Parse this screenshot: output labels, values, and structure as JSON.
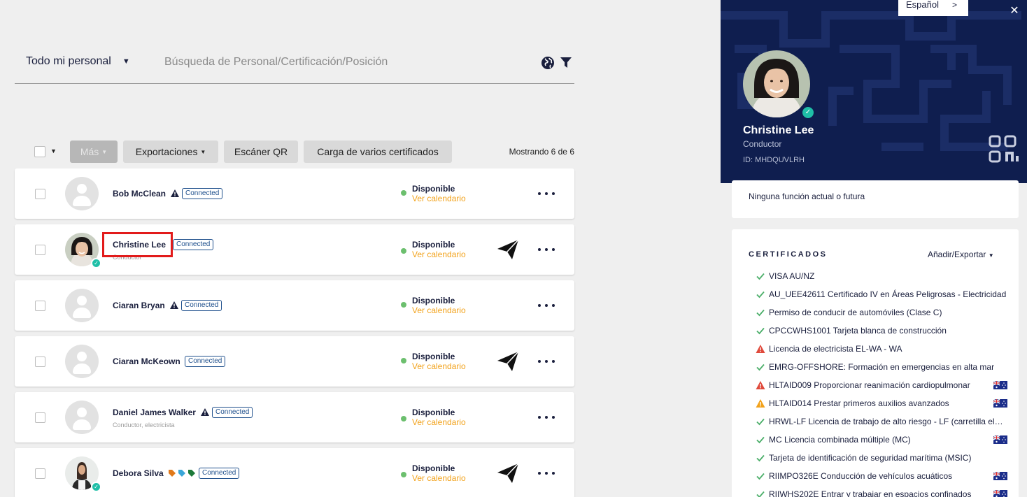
{
  "search": {
    "filter_label": "Todo mi personal",
    "placeholder": "Búsqueda de Personal/Certificación/Posición"
  },
  "toolbar": {
    "more_label": "Más",
    "exports_label": "Exportaciones",
    "qr_label": "Escáner QR",
    "bulk_label": "Carga de varios certificados",
    "showing": "Mostrando 6 de 6"
  },
  "people": [
    {
      "name": "Bob McClean",
      "role": "",
      "status": "Connected",
      "availability": "Disponible",
      "calendar": "Ver calendario"
    },
    {
      "name": "Christine Lee",
      "role": "Conductor",
      "status": "Connected",
      "availability": "Disponible",
      "calendar": "Ver calendario"
    },
    {
      "name": "Ciaran Bryan",
      "role": "",
      "status": "Connected",
      "availability": "Disponible",
      "calendar": "Ver calendario"
    },
    {
      "name": "Ciaran McKeown",
      "role": "",
      "status": "Connected",
      "availability": "Disponible",
      "calendar": "Ver calendario"
    },
    {
      "name": "Daniel James Walker",
      "role": "Conductor, electricista",
      "status": "Connected",
      "availability": "Disponible",
      "calendar": "Ver calendario"
    },
    {
      "name": "Debora Silva",
      "role": "",
      "status": "Connected",
      "availability": "Disponible",
      "calendar": "Ver calendario"
    }
  ],
  "profile": {
    "language": "Español",
    "name": "Christine Lee",
    "role": "Conductor",
    "id": "ID: MHDQUVLRH",
    "roles_text": "Ninguna función actual o futura",
    "certs_title": "CERTIFICADOS",
    "certs_export": "Añadir/Exportar",
    "certs": [
      {
        "text": "VISA AU/NZ",
        "status": "ok",
        "flag": false
      },
      {
        "text": "AU_UEE42611 Certificado IV en Áreas Peligrosas - Electricidad",
        "status": "ok",
        "flag": false
      },
      {
        "text": "Permiso de conducir de automóviles (Clase C)",
        "status": "ok",
        "flag": false
      },
      {
        "text": "CPCCWHS1001 Tarjeta blanca de construcción",
        "status": "ok",
        "flag": false
      },
      {
        "text": "Licencia de electricista EL-WA - WA",
        "status": "expired",
        "flag": false
      },
      {
        "text": "EMRG-OFFSHORE: Formación en emergencias en alta mar",
        "status": "ok",
        "flag": false
      },
      {
        "text": "HLTAID009 Proporcionar reanimación cardiopulmonar",
        "status": "expired",
        "flag": true
      },
      {
        "text": "HLTAID014 Prestar primeros auxilios avanzados",
        "status": "warning",
        "flag": true
      },
      {
        "text": "HRWL-LF Licencia de trabajo de alto riesgo - LF (carretilla elevadora)",
        "status": "ok",
        "flag": false
      },
      {
        "text": "MC Licencia combinada múltiple (MC)",
        "status": "ok",
        "flag": true
      },
      {
        "text": "Tarjeta de identificación de seguridad marítima (MSIC)",
        "status": "ok",
        "flag": false
      },
      {
        "text": "RIIMPO326E Conducción de vehículos acuáticos",
        "status": "ok",
        "flag": true
      },
      {
        "text": "RIIWHS202E Entrar y trabajar en espacios confinados",
        "status": "ok",
        "flag": true
      }
    ]
  },
  "colors": {
    "navy": "#0f1e4f",
    "accent_orange": "#f2a21b",
    "verified_teal": "#1fbfa7",
    "available_green": "#6cbf6e",
    "error_red": "#e04a3c",
    "warning_amber": "#f2a21b"
  },
  "icons": [
    "globe-icon",
    "funnel-icon",
    "send-icon",
    "more-icon",
    "warning-icon",
    "check-icon",
    "qr-icon",
    "close-icon",
    "australia-flag-icon"
  ]
}
